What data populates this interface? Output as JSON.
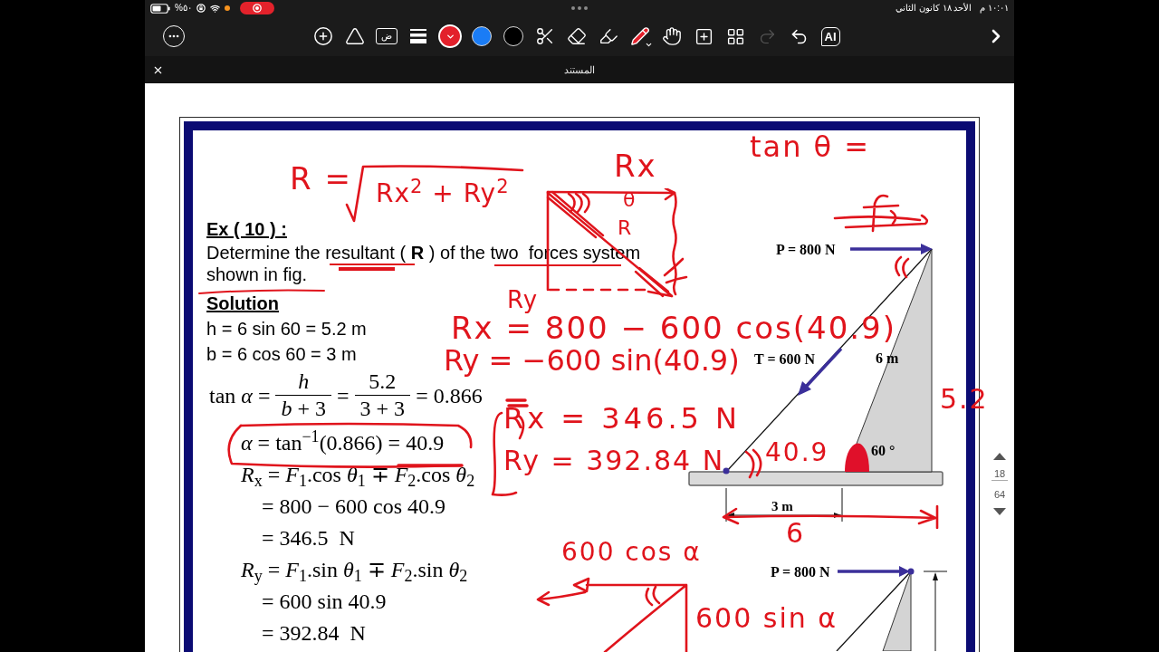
{
  "status_bar": {
    "battery": "%٥٠",
    "date": "الأحد ١٨ كانون الثاني",
    "time": "١٠:٠١ م"
  },
  "toolbar": {
    "insert": [
      {
        "kind": "add"
      },
      {
        "kind": "shapes"
      },
      {
        "kind": "text",
        "label": "ض"
      },
      {
        "kind": "line-width"
      }
    ],
    "colors": [
      {
        "color": "#e3202b",
        "selected": true
      },
      {
        "color": "#1a7cf5",
        "selected": false
      },
      {
        "color": "#000000",
        "selected": false
      }
    ],
    "tools": [
      {
        "kind": "lasso",
        "selected": false
      },
      {
        "kind": "eraser",
        "selected": false
      },
      {
        "kind": "highlighter",
        "selected": false
      },
      {
        "kind": "pen",
        "selected": true
      },
      {
        "kind": "hand",
        "selected": false
      }
    ],
    "page_actions": [
      {
        "kind": "add-page"
      },
      {
        "kind": "thumbnails"
      }
    ],
    "history": [
      {
        "kind": "redo",
        "disabled": true
      },
      {
        "kind": "undo",
        "disabled": false
      }
    ],
    "ai_button": "AI"
  },
  "document": {
    "title": "المستند",
    "current_page": "18",
    "page_count": "64"
  },
  "page": {
    "heading": "Ex ( 10 ) :",
    "problem": "Determine the resultant ( **R** ) of the two  forces system shown in fig.",
    "solution_heading": "Solution",
    "lines": [
      "h = 6 sin 60 = 5.2 m",
      "b = 6 cos 60 = 3 m"
    ],
    "equations": [
      {
        "kind": "fraction-row",
        "tokens": [
          {
            "kind": "text",
            "text": "tan *α* ="
          },
          {
            "kind": "fraction",
            "num": "*h*",
            "den": "*b* + 3"
          },
          {
            "kind": "text",
            "text": "="
          },
          {
            "kind": "fraction",
            "num": "5.2",
            "den": "3 + 3"
          },
          {
            "kind": "text",
            "text": "= 0.866"
          }
        ]
      },
      {
        "kind": "equation",
        "text": "*α* = tan$^{−1}$(0.866) = 40.9"
      },
      {
        "kind": "equation",
        "text": "*R*$_{x}$ = *F*$_{1}$.cos *θ*$_{1}$ ∓ *F*$_{2}$.cos *θ*$_{2}$"
      },
      {
        "kind": "continuation",
        "text": "= 800 − 600 cos 40.9"
      },
      {
        "kind": "continuation",
        "text": "= 346.5  N"
      },
      {
        "kind": "equation",
        "text": "*R*$_{y}$ = *F*$_{1}$.sin *θ*$_{1}$ ∓ *F*$_{2}$.sin *θ*$_{2}$"
      },
      {
        "kind": "continuation",
        "text": "= 600 sin 40.9"
      },
      {
        "kind": "continuation",
        "text": "= 392.84  N"
      }
    ]
  },
  "figure": {
    "top": {
      "force_p": "P = 800 N",
      "force_t": "T = 600 N",
      "length": "6 m",
      "angle": "60 °",
      "base": "3 m"
    },
    "bottom": {
      "force_p": "P = 800 N"
    }
  },
  "ink_notes": [
    "R =",
    "Rx$^{2}$ + Ry$^{2}$",
    "Rx",
    "θ",
    "R",
    "Ry",
    "tan θ =",
    "Rx = 800 − 600 cos(40.9)",
    "Ry = −600 sin(40.9)",
    "Rx = 346.5 N",
    "Ry = 392.84 N",
    "40.9",
    "5.2",
    "6",
    "600 cos α",
    "600 sin α"
  ]
}
